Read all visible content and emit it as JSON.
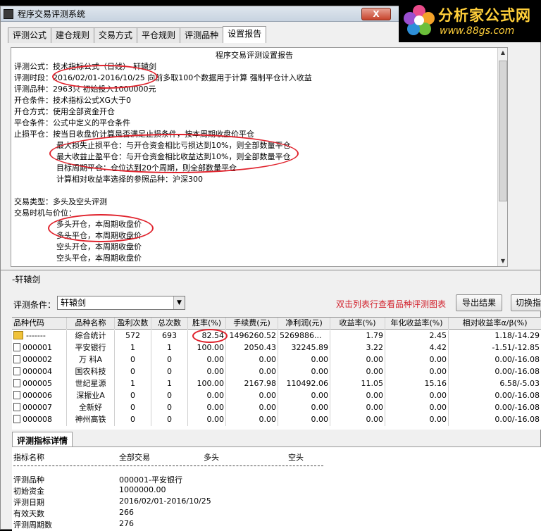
{
  "window": {
    "title": "程序交易评测系统",
    "close_label": "X"
  },
  "logo": {
    "brand": "分析家公式网",
    "url": "www.88gs.com"
  },
  "tabs": [
    "评测公式",
    "建仓规则",
    "交易方式",
    "平仓规则",
    "评测品种",
    "设置报告"
  ],
  "report": {
    "title": "程序交易评测设置报告",
    "lines": [
      "评测公式：技术指标公式（日线）-轩辕剑",
      "评测时段：2016/02/01-2016/10/25 向前多取100个数据用于计算 强制平仓计入收益",
      "评测品种：2963只  初始投入1000000元",
      "开仓条件：技术指标公式XG大于0",
      "开仓方式：使用全部资金开仓",
      "平仓条件：公式中定义的平仓条件",
      "止损平仓：按当日收盘价计算是否满足止损条件，按本周期收盘价平仓",
      "最大损失止损平仓：与开仓资金相比亏损达到10%，则全部数量平仓",
      "最大收益止盈平仓：与开仓资金相比收益达到10%，则全部数量平仓",
      "目标周期平仓：仓位达到20个周期，则全部数量平仓",
      "计算相对收益率选择的参照品种：沪深300",
      "",
      "交易类型：多头及空头评测",
      "交易时机与价位：",
      "多头开仓，本周期收盘价",
      "多头平仓，本周期收盘价",
      "空头开仓，本周期收盘价",
      "空头平仓，本周期收盘价"
    ]
  },
  "results": {
    "title": "-轩辕剑",
    "condition_label": "评测条件：",
    "condition_value": "轩辕剑",
    "hint": "双击列表行查看品种评测图表",
    "export_button": "导出结果",
    "switch_button": "切换指",
    "columns": [
      "品种代码",
      "品种名称",
      "盈利次数",
      "总次数",
      "胜率(%)",
      "手续费(元)",
      "净利润(元)",
      "收益率(%)",
      "年化收益率(%)",
      "相对收益率α/β(%)"
    ],
    "rows": [
      [
        "-------",
        "综合统计",
        "572",
        "693",
        "82.54",
        "1496260.52",
        "5269886...",
        "1.79",
        "2.45",
        "1.18/-14.29"
      ],
      [
        "000001",
        "平安银行",
        "1",
        "1",
        "100.00",
        "2050.43",
        "32245.89",
        "3.22",
        "4.42",
        "-1.51/-12.85"
      ],
      [
        "000002",
        "万 科A",
        "0",
        "0",
        "0.00",
        "0.00",
        "0.00",
        "0.00",
        "0.00",
        "0.00/-16.08"
      ],
      [
        "000004",
        "国农科技",
        "0",
        "0",
        "0.00",
        "0.00",
        "0.00",
        "0.00",
        "0.00",
        "0.00/-16.08"
      ],
      [
        "000005",
        "世纪星源",
        "1",
        "1",
        "100.00",
        "2167.98",
        "110492.06",
        "11.05",
        "15.16",
        "6.58/-5.03"
      ],
      [
        "000006",
        "深振业A",
        "0",
        "0",
        "0.00",
        "0.00",
        "0.00",
        "0.00",
        "0.00",
        "0.00/-16.08"
      ],
      [
        "000007",
        "全新好",
        "0",
        "0",
        "0.00",
        "0.00",
        "0.00",
        "0.00",
        "0.00",
        "0.00/-16.08"
      ],
      [
        "000008",
        "神州高铁",
        "0",
        "0",
        "0.00",
        "0.00",
        "0.00",
        "0.00",
        "0.00",
        "0.00/-16.08"
      ]
    ]
  },
  "details": {
    "tab_label": "评测指标详情",
    "header": [
      "指标名称",
      "全部交易",
      "多头",
      "空头"
    ],
    "rows": [
      [
        "评测品种",
        "000001-平安银行"
      ],
      [
        "初始资金",
        "1000000.00"
      ],
      [
        "评测日期",
        "2016/02/01-2016/10/25"
      ],
      [
        "有效天数",
        "266"
      ],
      [
        "评测周期数",
        "276"
      ]
    ]
  }
}
